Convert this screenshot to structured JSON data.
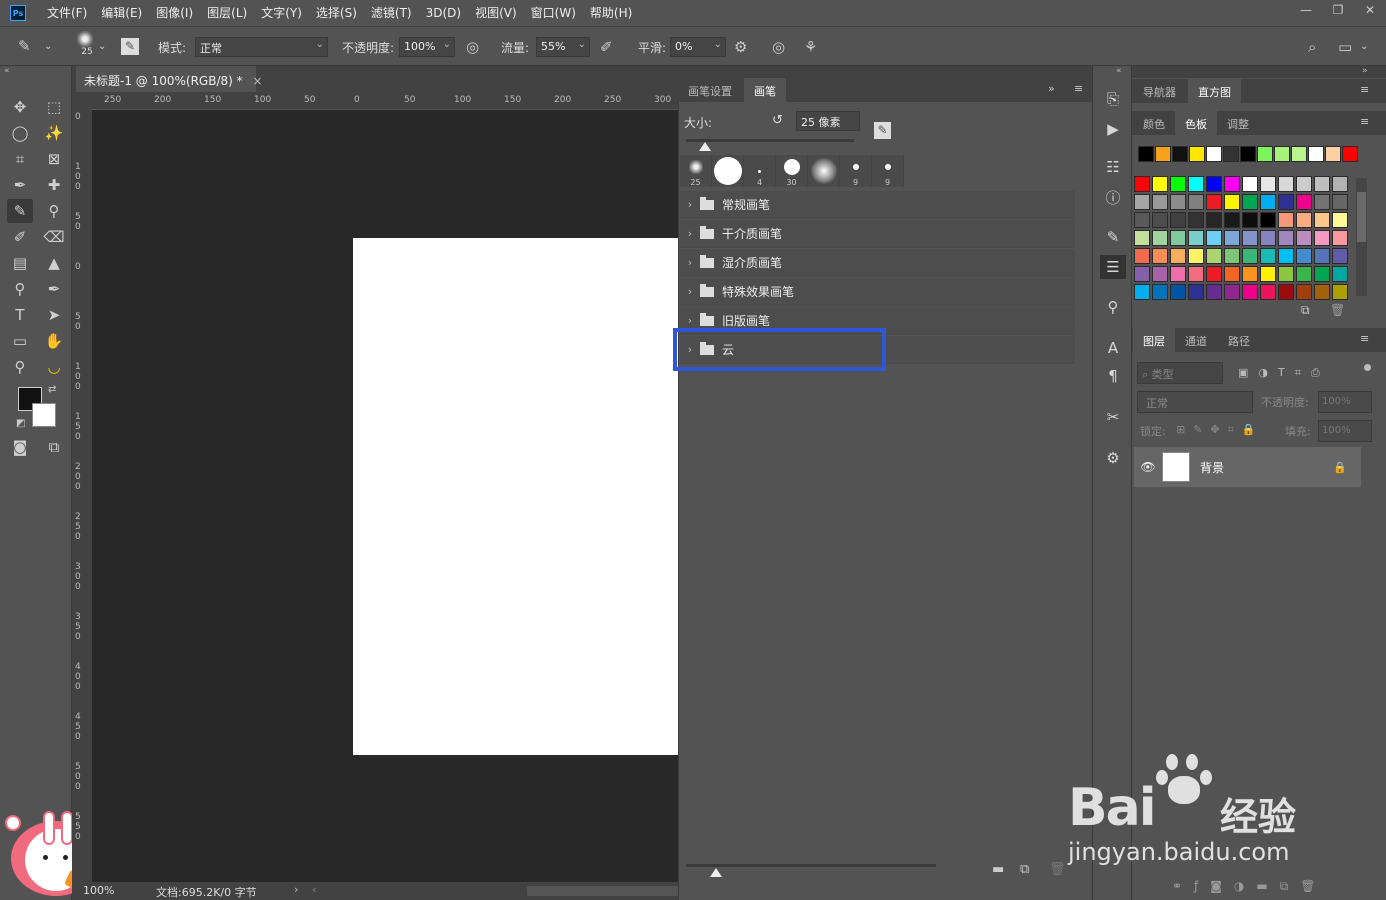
{
  "app": {
    "logo": "Ps"
  },
  "menu": [
    "文件(F)",
    "编辑(E)",
    "图像(I)",
    "图层(L)",
    "文字(Y)",
    "选择(S)",
    "滤镜(T)",
    "3D(D)",
    "视图(V)",
    "窗口(W)",
    "帮助(H)"
  ],
  "window_controls": {
    "minimize": "—",
    "restore": "❐",
    "close": "✕"
  },
  "options": {
    "brush_size": "25",
    "mode_label": "模式:",
    "mode_value": "正常",
    "opacity_label": "不透明度:",
    "opacity_value": "100%",
    "flow_label": "流量:",
    "flow_value": "55%",
    "smooth_label": "平滑:",
    "smooth_value": "0%"
  },
  "document": {
    "tab_title": "未标题-1 @ 100%(RGB/8) *",
    "tab_close": "×",
    "zoom": "100%",
    "doc_info": "文档:695.2K/0 字节",
    "ruler_h": [
      "250",
      "200",
      "150",
      "100",
      "50",
      "0",
      "50",
      "100",
      "150",
      "200",
      "250",
      "300"
    ],
    "ruler_v": [
      "0",
      "1 0 0",
      "5 0",
      "0",
      "5 0",
      "1 0 0",
      "1 5 0",
      "2 0 0",
      "2 5 0",
      "3 0 0",
      "3 5 0",
      "4 0 0",
      "4 5 0",
      "5 0 0",
      "5 5 0"
    ]
  },
  "brush_panel": {
    "tabs": [
      "画笔设置",
      "画笔"
    ],
    "active_tab": "画笔",
    "size_label": "大小:",
    "size_value": "25 像素",
    "presets": [
      {
        "num": "25",
        "kind": "texture"
      },
      {
        "num": "",
        "kind": "hard-large"
      },
      {
        "num": "4",
        "kind": "tiny"
      },
      {
        "num": "30",
        "kind": "hard-medium"
      },
      {
        "num": "",
        "kind": "soft"
      },
      {
        "num": "9",
        "kind": "small"
      },
      {
        "num": "9",
        "kind": "small"
      }
    ],
    "groups": [
      "常规画笔",
      "干介质画笔",
      "湿介质画笔",
      "特殊效果画笔",
      "旧版画笔",
      "云"
    ],
    "highlighted_group": "云"
  },
  "right_panels": {
    "top_tabs": [
      "导航器",
      "直方图"
    ],
    "top_active": "直方图",
    "swatch_tabs": [
      "颜色",
      "色板",
      "调整"
    ],
    "swatch_active": "色板",
    "recent_swatches": [
      "#000000",
      "#f7a21d",
      "#111111",
      "#ffe600",
      "#ffffff",
      "#333333",
      "#000000",
      "#7ff35c",
      "#a6f27a",
      "#b8f58e",
      "#ffffff",
      "#fcd0a5",
      "#ff0000"
    ],
    "swatches": [
      [
        "#ff0000",
        "#ffff00",
        "#00ff00",
        "#00ffff",
        "#0000ff",
        "#ff00ff",
        "#ffffff",
        "#e6e6e6",
        "#d9d9d9",
        "#cccccc",
        "#bfbfbf",
        "#b3b3b3"
      ],
      [
        "#a6a6a6",
        "#999999",
        "#8c8c8c",
        "#808080",
        "#ed1c24",
        "#fff200",
        "#00a651",
        "#00aeef",
        "#2e3192",
        "#ec008c",
        "#737373",
        "#666666"
      ],
      [
        "#595959",
        "#4d4d4d",
        "#404040",
        "#333333",
        "#262626",
        "#1a1a1a",
        "#0d0d0d",
        "#000000",
        "#f7977a",
        "#f9ad81",
        "#fdc68a",
        "#fff79a"
      ],
      [
        "#c4df9b",
        "#a3d39c",
        "#82ca9d",
        "#7bcdc8",
        "#6ecff6",
        "#7ea7d8",
        "#8493ca",
        "#8882be",
        "#a187be",
        "#bc8dbf",
        "#f49ac2",
        "#f6989d"
      ],
      [
        "#f26c4f",
        "#f68e55",
        "#fbaf5c",
        "#fff467",
        "#acd372",
        "#7cc576",
        "#3bb878",
        "#1abbb4",
        "#00bff3",
        "#438ccb",
        "#5574b9",
        "#605ca8"
      ],
      [
        "#855fa8",
        "#a763a8",
        "#f06ea9",
        "#f26d7d",
        "#ed1c24",
        "#f26522",
        "#f7941d",
        "#fff200",
        "#8dc63f",
        "#39b54a",
        "#00a651",
        "#00a99d"
      ],
      [
        "#00aeef",
        "#0072bc",
        "#0054a6",
        "#2e3192",
        "#662d91",
        "#92278f",
        "#ec008c",
        "#ed145b",
        "#9e0b0f",
        "#a0410d",
        "#a36209",
        "#aba000"
      ]
    ],
    "layers_tabs": [
      "图层",
      "通道",
      "路径"
    ],
    "layers_active": "图层",
    "layer_filter": "类型",
    "blend_mode": "正常",
    "opacity_label": "不透明度:",
    "opacity_value": "100%",
    "lock_label": "锁定:",
    "fill_label": "填充:",
    "fill_value": "100%",
    "layer_name": "背景"
  },
  "watermark": {
    "brand": "Bai",
    "brand2": "经验",
    "domain": "jingyan.baidu.com"
  }
}
